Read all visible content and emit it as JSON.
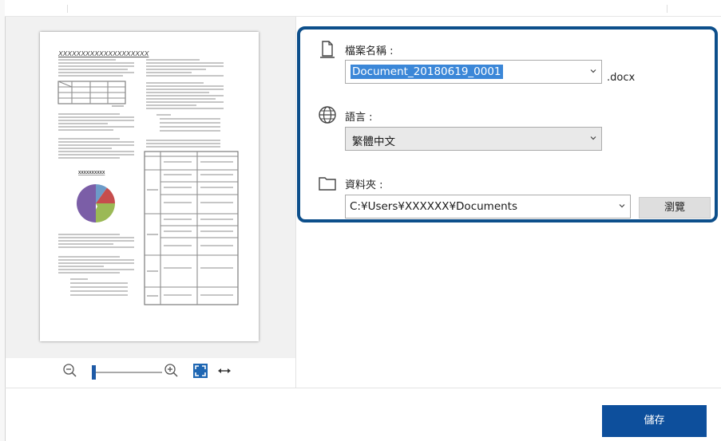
{
  "file_name": {
    "label": "檔案名稱 :",
    "value": "Document_20180619_0001",
    "extension": ".docx"
  },
  "language": {
    "label": "語言 :",
    "value": "繁體中文"
  },
  "folder": {
    "label": "資料夾 :",
    "value": "C:¥Users¥XXXXXX¥Documents",
    "browse_label": "瀏覽"
  },
  "actions": {
    "save_label": "儲存"
  },
  "preview": {
    "heading": "XXXXXXXXXXXXXXXXXXXX",
    "chart_title": "XXXXXXXXXX"
  },
  "colors": {
    "accent": "#0d4f8b",
    "save_button": "#0d4f9c",
    "selection": "#3b87d8"
  },
  "icons": {
    "file_name": "document-icon",
    "language": "globe-icon",
    "folder": "folder-icon",
    "zoom_out": "zoom-out-icon",
    "zoom_in": "zoom-in-icon",
    "fit": "fit-page-icon",
    "fit_width": "fit-width-icon"
  }
}
